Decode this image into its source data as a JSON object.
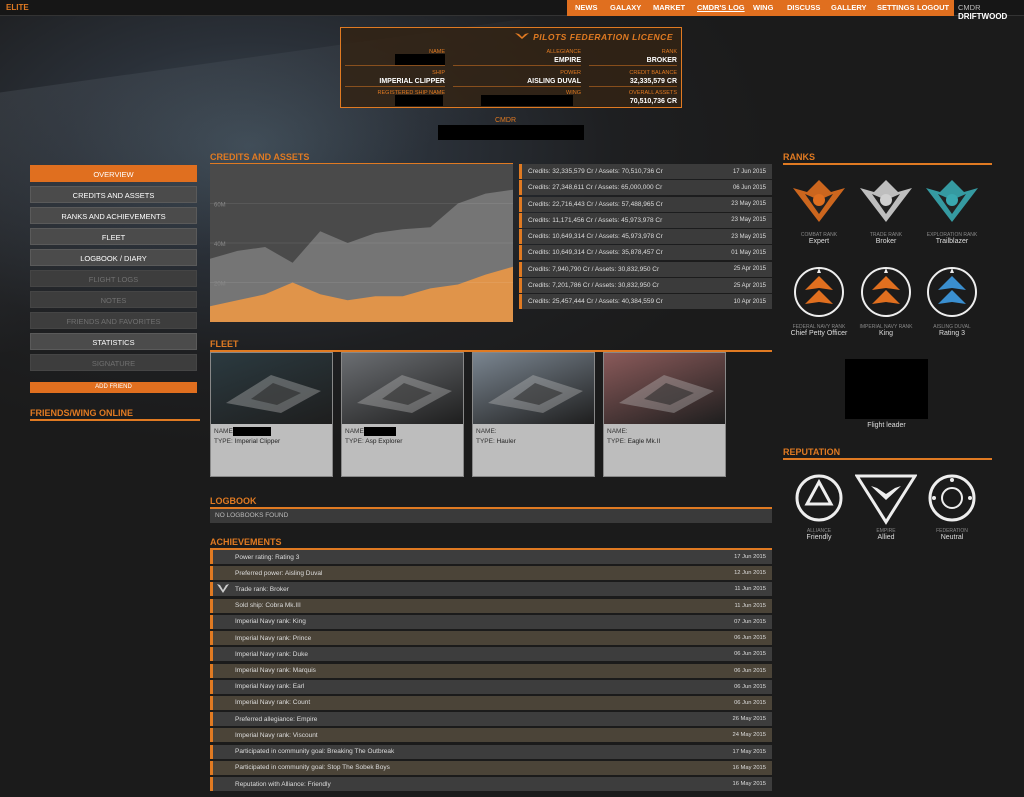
{
  "nav": {
    "logo": "ELITE",
    "items": [
      "NEWS",
      "GALAXY",
      "MARKET",
      "CMDR'S LOG",
      "WING",
      "DISCUSS",
      "GALLERY",
      "SETTINGS",
      "LOGOUT"
    ],
    "cmdr_prefix": "CMDR",
    "cmdr_name": "DRIFTWOOD"
  },
  "licence": {
    "title": "PILOTS FEDERATION LICENCE",
    "name_label": "NAME",
    "allegiance_label": "ALLEGIANCE",
    "allegiance": "EMPIRE",
    "rank_label": "RANK",
    "rank": "BROKER",
    "ship_label": "SHIP",
    "ship": "IMPERIAL CLIPPER",
    "power_label": "POWER",
    "power": "AISLING DUVAL",
    "credit_label": "CREDIT BALANCE",
    "credit": "32,335,579 CR",
    "regship_label": "REGISTERED SHIP NAME",
    "wing_label": "WING",
    "assets_label": "OVERALL ASSETS",
    "assets": "70,510,736 CR",
    "cmdr_label": "CMDR"
  },
  "menu": {
    "items": [
      {
        "label": "OVERVIEW",
        "state": "active"
      },
      {
        "label": "CREDITS AND ASSETS",
        "state": "normal"
      },
      {
        "label": "RANKS AND ACHIEVEMENTS",
        "state": "normal"
      },
      {
        "label": "FLEET",
        "state": "normal"
      },
      {
        "label": "LOGBOOK / DIARY",
        "state": "normal"
      },
      {
        "label": "FLIGHT LOGS",
        "state": "disabled"
      },
      {
        "label": "NOTES",
        "state": "disabled"
      },
      {
        "label": "FRIENDS AND FAVORITES",
        "state": "disabled"
      },
      {
        "label": "STATISTICS",
        "state": "normal"
      },
      {
        "label": "SIGNATURE",
        "state": "disabled"
      }
    ],
    "add_friend": "ADD FRIEND",
    "friends_heading": "FRIENDS/WING ONLINE"
  },
  "credits_heading": "CREDITS AND ASSETS",
  "chart_data": {
    "type": "area",
    "y_ticks": [
      "20M",
      "40M",
      "60M"
    ],
    "ylim": [
      0,
      80000000
    ],
    "series": [
      {
        "values": [
          32000000,
          36000000,
          38000000,
          30000000,
          46000000,
          40000000,
          45000000,
          47000000,
          48000000,
          60000000,
          65000000,
          67000000
        ]
      },
      {
        "values": [
          8000000,
          11000000,
          14000000,
          20000000,
          14000000,
          11000000,
          13000000,
          13000000,
          17000000,
          19000000,
          24000000,
          28000000
        ]
      }
    ]
  },
  "credits_list": [
    {
      "text": "Credits: 32,335,579 Cr / Assets: 70,510,736 Cr",
      "date": "17 Jun 2015"
    },
    {
      "text": "Credits: 27,348,611 Cr / Assets: 65,000,000 Cr",
      "date": "06 Jun 2015"
    },
    {
      "text": "Credits: 22,716,443 Cr / Assets: 57,488,965 Cr",
      "date": "23 May 2015"
    },
    {
      "text": "Credits: 11,171,456 Cr / Assets: 45,973,978 Cr",
      "date": "23 May 2015"
    },
    {
      "text": "Credits: 10,649,314 Cr / Assets: 45,973,978 Cr",
      "date": "23 May 2015"
    },
    {
      "text": "Credits: 10,649,314 Cr / Assets: 35,878,457 Cr",
      "date": "01 May 2015"
    },
    {
      "text": "Credits: 7,940,790 Cr / Assets: 30,832,950 Cr",
      "date": "25 Apr 2015"
    },
    {
      "text": "Credits: 7,201,786 Cr / Assets: 30,832,950 Cr",
      "date": "25 Apr 2015"
    },
    {
      "text": "Credits: 25,457,444 Cr / Assets: 40,384,559 Cr",
      "date": "10 Apr 2015"
    }
  ],
  "fleet_heading": "FLEET",
  "fleet": [
    {
      "name_label": "NAME:",
      "type_label": "TYPE:",
      "type": "Imperial Clipper",
      "color": "#2b3a40"
    },
    {
      "name_label": "NAME:",
      "type_label": "TYPE:",
      "type": "Asp Explorer",
      "color": "#6b6e72"
    },
    {
      "name_label": "NAME:",
      "type_label": "TYPE:",
      "type": "Hauler",
      "color": "#7a8590"
    },
    {
      "name_label": "NAME:",
      "type_label": "TYPE:",
      "type": "Eagle Mk.II",
      "color": "#8a5a5a"
    }
  ],
  "logbook_heading": "LOGBOOK",
  "logbook_empty": "NO LOGBOOKS FOUND",
  "achievements_heading": "ACHIEVEMENTS",
  "achievements": [
    {
      "text": "Power rating: Rating 3",
      "date": "17 Jun 2015"
    },
    {
      "text": "Preferred power: Aisling Duval",
      "date": "12 Jun 2015"
    },
    {
      "text": "Trade rank: Broker",
      "date": "11 Jun 2015",
      "icon": "trade-rank-icon"
    },
    {
      "text": "Sold ship: Cobra Mk.III",
      "date": "11 Jun 2015"
    },
    {
      "text": "Imperial Navy rank: King",
      "date": "07 Jun 2015"
    },
    {
      "text": "Imperial Navy rank: Prince",
      "date": "06 Jun 2015"
    },
    {
      "text": "Imperial Navy rank: Duke",
      "date": "06 Jun 2015"
    },
    {
      "text": "Imperial Navy rank: Marquis",
      "date": "06 Jun 2015"
    },
    {
      "text": "Imperial Navy rank: Earl",
      "date": "06 Jun 2015"
    },
    {
      "text": "Imperial Navy rank: Count",
      "date": "06 Jun 2015"
    },
    {
      "text": "Preferred allegiance: Empire",
      "date": "26 May 2015"
    },
    {
      "text": "Imperial Navy rank: Viscount",
      "date": "24 May 2015"
    },
    {
      "text": "Participated in community goal: Breaking The Outbreak",
      "date": "17 May 2015"
    },
    {
      "text": "Participated in community goal: Stop The Sobek Boys",
      "date": "16 May 2015"
    },
    {
      "text": "Reputation with Alliance: Friendly",
      "date": "16 May 2015"
    }
  ],
  "ranks_heading": "RANKS",
  "ranks": [
    {
      "label": "COMBAT RANK",
      "value": "Expert",
      "icon": "combat-rank-icon",
      "color": "#e06f1f"
    },
    {
      "label": "TRADE RANK",
      "value": "Broker",
      "icon": "trade-rank-icon",
      "color": "#d0d0d0"
    },
    {
      "label": "EXPLORATION RANK",
      "value": "Trailblazer",
      "icon": "exploration-rank-icon",
      "color": "#39a8b0"
    },
    {
      "label": "FEDERAL NAVY RANK",
      "value": "Chief Petty Officer",
      "icon": "federal-navy-icon",
      "color": "#e06f1f"
    },
    {
      "label": "IMPERIAL NAVY RANK",
      "value": "King",
      "icon": "imperial-navy-icon",
      "color": "#e06f1f"
    },
    {
      "label": "AISLING DUVAL",
      "value": "Rating 3",
      "icon": "aisling-duval-icon",
      "color": "#3a8fd0"
    }
  ],
  "wing_rank": "Flight leader",
  "reputation_heading": "REPUTATION",
  "reputation": [
    {
      "label": "ALLIANCE",
      "value": "Friendly",
      "icon": "alliance-icon"
    },
    {
      "label": "EMPIRE",
      "value": "Allied",
      "icon": "empire-icon"
    },
    {
      "label": "FEDERATION",
      "value": "Neutral",
      "icon": "federation-icon"
    }
  ],
  "colors": {
    "accent": "#e06f1f",
    "panel": "#3b3b3b"
  }
}
